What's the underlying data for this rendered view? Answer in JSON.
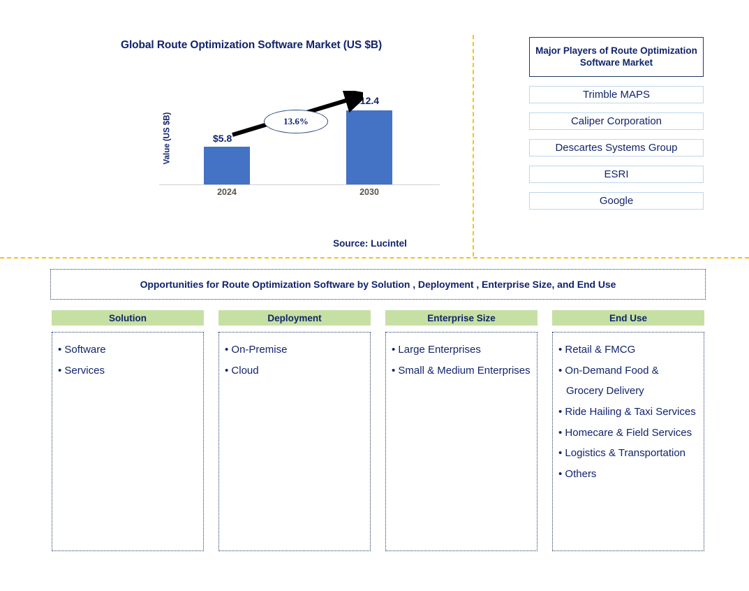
{
  "chart_panel": {
    "title": "Global Route Optimization Software Market (US $B)",
    "y_axis_label": "Value (US $B)",
    "source": "Source: Lucintel",
    "cagr_label": "13.6%"
  },
  "chart_data": {
    "type": "bar",
    "title": "Global Route Optimization Software Market (US $B)",
    "categories": [
      "2024",
      "2030"
    ],
    "values": [
      5.8,
      12.4
    ],
    "value_labels": [
      "$5.8",
      "$12.4"
    ],
    "xlabel": "",
    "ylabel": "Value (US $B)",
    "ylim": [
      0,
      14
    ],
    "grid": false,
    "legend": "none",
    "annotations": [
      {
        "text": "13.6%",
        "type": "cagr-arrow",
        "from": "2024",
        "to": "2030"
      }
    ],
    "series_color": "#4472C4",
    "source": "Source: Lucintel"
  },
  "players_panel": {
    "title": "Major Players of Route Optimization Software Market",
    "players": [
      "Trimble MAPS",
      "Caliper Corporation",
      "Descartes Systems Group",
      "ESRI",
      "Google"
    ]
  },
  "opportunities": {
    "header": "Opportunities for Route Optimization Software by Solution , Deployment , Enterprise Size, and End Use",
    "columns": [
      {
        "header": "Solution",
        "items": [
          "Software",
          "Services"
        ]
      },
      {
        "header": "Deployment",
        "items": [
          "On-Premise",
          "Cloud"
        ]
      },
      {
        "header": "Enterprise Size",
        "items": [
          "Large Enterprises",
          "Small & Medium Enterprises"
        ]
      },
      {
        "header": "End Use",
        "items": [
          "Retail & FMCG",
          "On-Demand Food & Grocery Delivery",
          "Ride Hailing &  Taxi Services",
          "Homecare & Field Services",
          "Logistics & Transportation",
          "Others"
        ]
      }
    ]
  },
  "colors": {
    "bar": "#4472C4",
    "header_green": "#C6E0A3",
    "divider_orange": "#FFC000",
    "navy_text": "#11246B",
    "player_border": "#BDD7EE"
  }
}
